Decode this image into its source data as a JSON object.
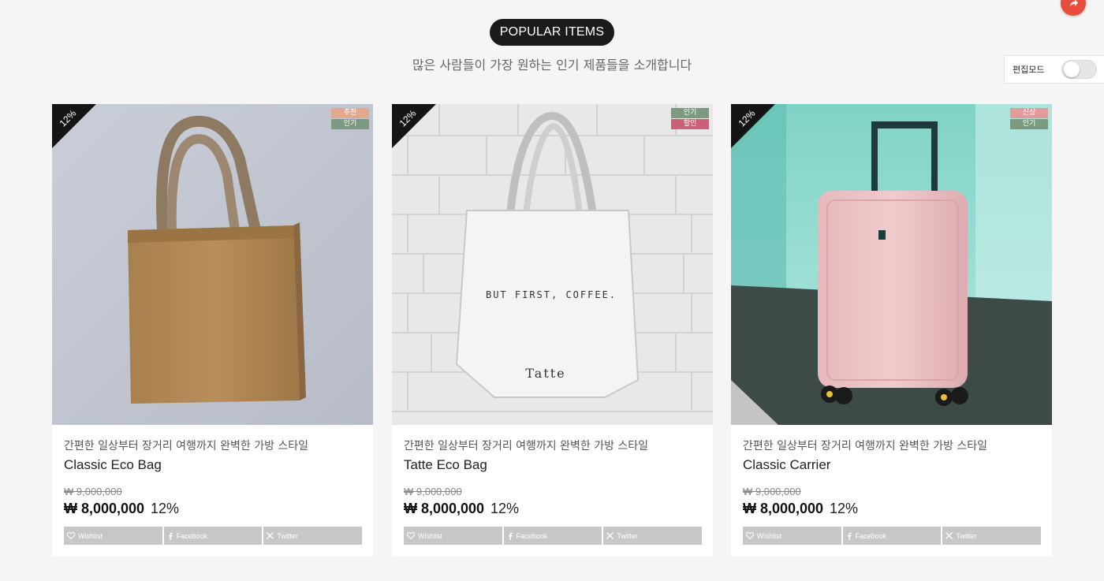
{
  "header": {
    "title": "POPULAR ITEMS",
    "subtitle": "많은 사람들이 가장 원하는 인기 제품들을 소개합니다"
  },
  "edit_mode": {
    "label": "편집모드",
    "enabled": false
  },
  "colors": {
    "badge_recommend": "#e3a98f",
    "badge_popular": "#7c9a80",
    "badge_sale": "#c96178",
    "badge_new": "#e29a9b",
    "share_button": "#c7c7c7",
    "fab": "#e84c3d"
  },
  "share_labels": {
    "wishlist": "Wishlist",
    "facebook": "Facebook",
    "twitter": "Twitter"
  },
  "products": [
    {
      "discount_ribbon": "12%",
      "badges": [
        {
          "label": "추천",
          "color": "#e3a98f"
        },
        {
          "label": "인기",
          "color": "#7c9a80"
        }
      ],
      "description": "간편한 일상부터 장거리 여행까지 완벽한 가방 스타일",
      "name": "Classic Eco Bag",
      "original_price": "₩ 9,000,000",
      "price": "₩ 8,000,000",
      "discount": "12%"
    },
    {
      "discount_ribbon": "12%",
      "badges": [
        {
          "label": "인기",
          "color": "#7c9a80"
        },
        {
          "label": "할인",
          "color": "#c96178"
        }
      ],
      "description": "간편한 일상부터 장거리 여행까지 완벽한 가방 스타일",
      "name": "Tatte Eco Bag",
      "original_price": "₩ 9,000,000",
      "price": "₩ 8,000,000",
      "discount": "12%",
      "image_text": {
        "line1": "BUT FIRST, COFFEE.",
        "brand": "Tatte"
      }
    },
    {
      "discount_ribbon": "12%",
      "badges": [
        {
          "label": "신상",
          "color": "#e29a9b"
        },
        {
          "label": "인기",
          "color": "#7c9a80"
        }
      ],
      "description": "간편한 일상부터 장거리 여행까지 완벽한 가방 스타일",
      "name": "Classic Carrier",
      "original_price": "₩ 9,000,000",
      "price": "₩ 8,000,000",
      "discount": "12%"
    }
  ]
}
